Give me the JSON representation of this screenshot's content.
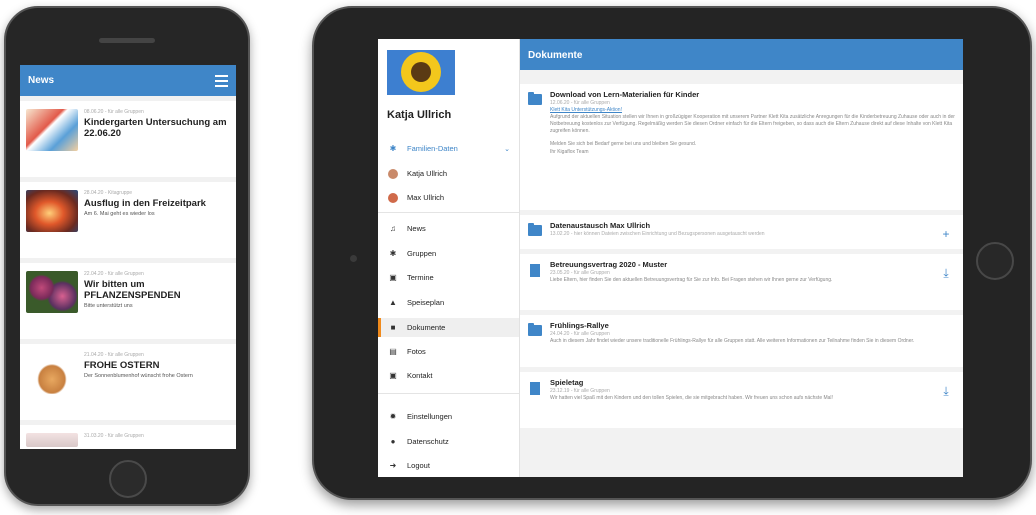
{
  "phone": {
    "header_title": "News",
    "news": [
      {
        "meta": "08.06.20 - für alle Gruppen",
        "title": "Kindergarten Untersuchung am 22.06.20",
        "text": "",
        "thumb_icon": "children-illustration"
      },
      {
        "meta": "28.04.20 - Kitagruppe",
        "title": "Ausflug in den Freizeitpark",
        "text": "Am 6. Mai geht es wieder los",
        "thumb_icon": "ride-photo"
      },
      {
        "meta": "22.04.20 - für alle Gruppen",
        "title": "Wir bitten um PFLANZENSPENDEN",
        "text": "Bitte unterstützt uns",
        "thumb_icon": "flowers-photo"
      },
      {
        "meta": "21.04.20 - für alle Gruppen",
        "title": "FROHE OSTERN",
        "text": "Der Sonnenblumenhof wünscht frohe Ostern",
        "thumb_icon": "bunny-illustration"
      },
      {
        "meta": "31.03.20 - für alle Gruppen",
        "title": "",
        "text": "",
        "thumb_icon": "drawing-photo"
      }
    ]
  },
  "tablet": {
    "user_name": "Katja Ullrich",
    "nav": {
      "family": "Familien-Daten",
      "member1": "Katja Ullrich",
      "member2": "Max Ullrich",
      "news": "News",
      "groups": "Gruppen",
      "dates": "Termine",
      "menu": "Speiseplan",
      "documents": "Dokumente",
      "photos": "Fotos",
      "contact": "Kontakt",
      "settings": "Einstellungen",
      "privacy": "Datenschutz",
      "logout": "Logout"
    },
    "main_title": "Dokumente",
    "docs": [
      {
        "title": "Download von Lern-Materialien für Kinder",
        "meta": "12.06.20 - für alle Gruppen",
        "link": "Klett Kita Unterstützungs-Aktion!",
        "text": "Aufgrund der aktuellen Situation stellen wir Ihnen in großzügiger Kooperation mit unserem Partner Klett Kita zusätzliche Anregungen für die Kinderbetreuung Zuhause oder auch in der Notbetreuung kostenlos zur Verfügung. Regelmäßig werden Sie diesen Ordner einfach für die Eltern freigeben, so dass auch die Eltern Zuhause direkt auf diese Inhalte von Klett Kita zugreifen können.",
        "text2": "Melden Sie sich bei Bedarf gerne bei uns und bleiben Sie gesund.",
        "text3": "Ihr Kigaflox Team"
      },
      {
        "title": "Datenaustausch Max Ullrich",
        "meta": "13.02.20 - hier können Dateien zwischen Einrichtung und Bezugspersonen ausgetauscht werden",
        "action": "+"
      },
      {
        "title": "Betreuungsvertrag 2020 - Muster",
        "meta": "23.05.20 - für alle Gruppen",
        "text": "Liebe Eltern, hier finden Sie den aktuellen Betreuungsvertrag für Sie zur Info. Bei Fragen stehen wir Ihnen gerne zur Verfügung.",
        "action": "⤓"
      },
      {
        "title": "Frühlings-Rallye",
        "meta": "24.04.20 - für alle Gruppen",
        "text": "Auch in diesem Jahr findet wieder unsere traditionelle Frühlings-Rallye für alle Gruppen statt. Alle weiteren Informationen zur Teilnahme finden Sie in diesem Ordner."
      },
      {
        "title": "Spieletag",
        "meta": "23.12.19 - für alle Gruppen",
        "text": "Wir hatten viel Spaß mit den Kindern und den tollen Spielen, die sie mitgebracht haben. Wir freuen uns schon aufs nächste Mal!",
        "action": "⤓"
      }
    ]
  },
  "colors": {
    "accent": "#3f86c8",
    "active_marker": "#f08a1c"
  }
}
